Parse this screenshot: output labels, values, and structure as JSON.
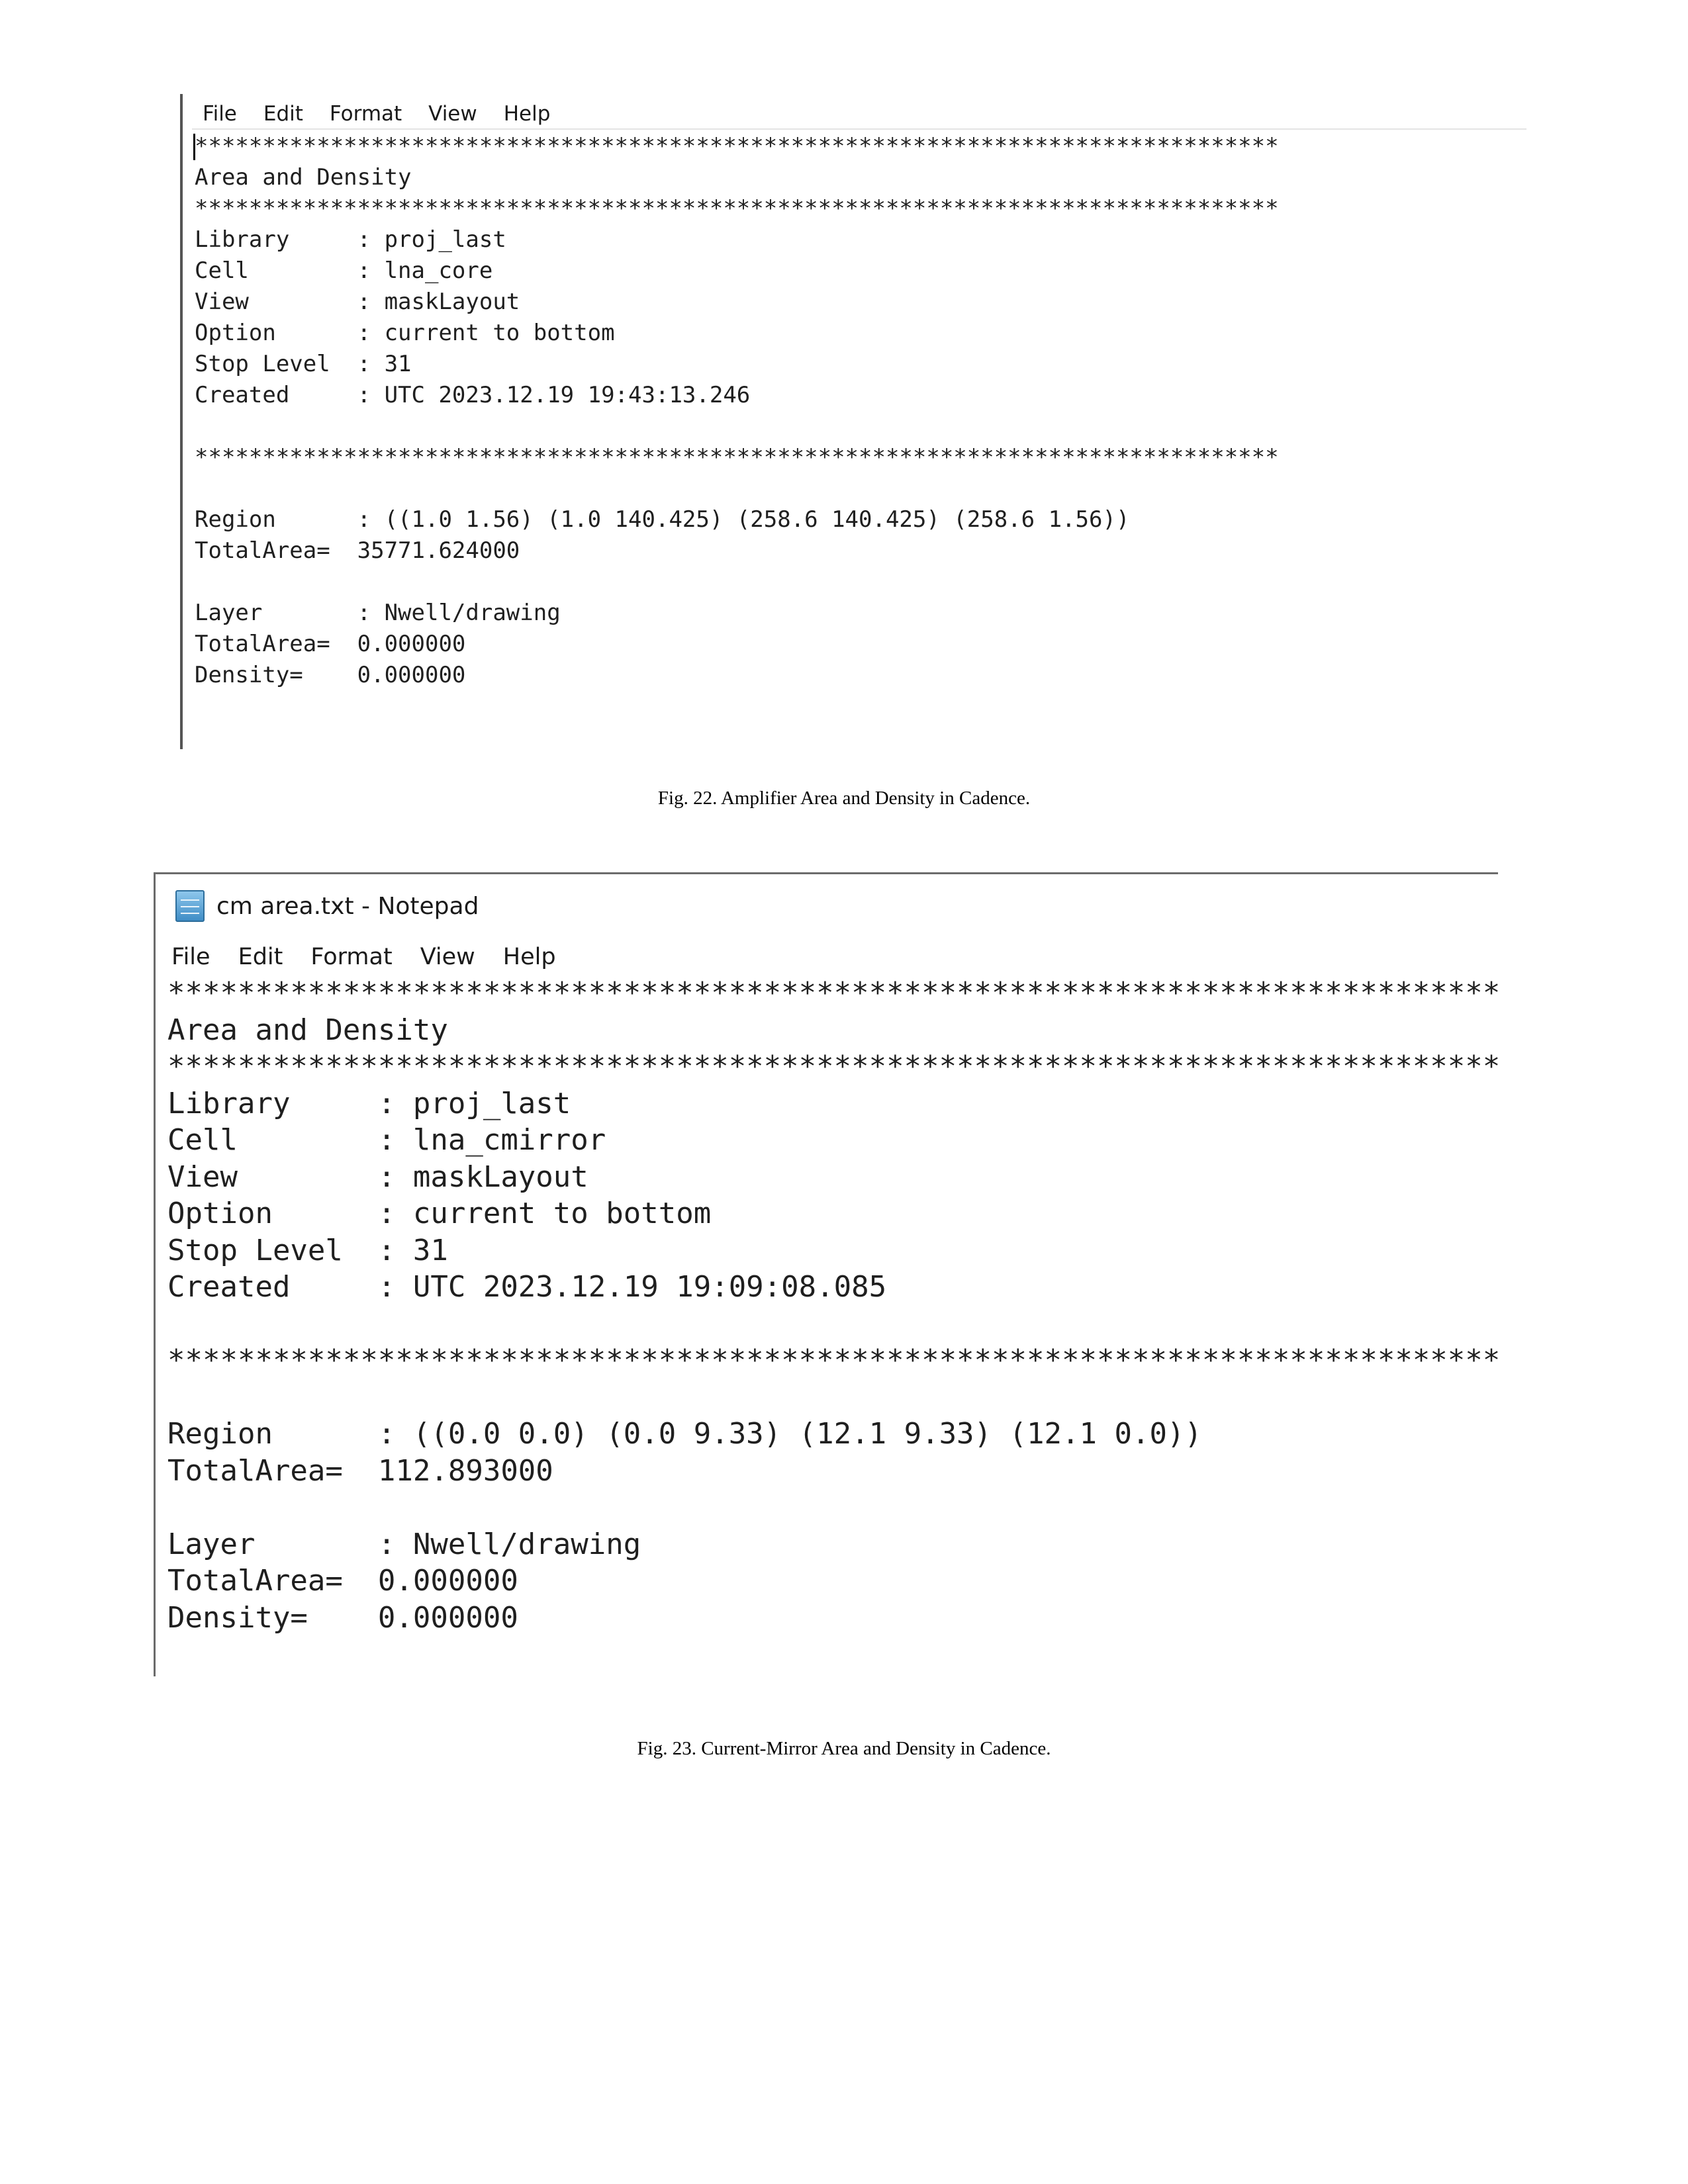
{
  "screenshot1": {
    "menu": [
      "File",
      "Edit",
      "Format",
      "View",
      "Help"
    ],
    "content": "********************************************************************************\nArea and Density\n********************************************************************************\nLibrary     : proj_last\nCell        : lna_core\nView        : maskLayout\nOption      : current to bottom\nStop Level  : 31\nCreated     : UTC 2023.12.19 19:43:13.246\n\n********************************************************************************\n\nRegion      : ((1.0 1.56) (1.0 140.425) (258.6 140.425) (258.6 1.56))\nTotalArea=  35771.624000\n\nLayer       : Nwell/drawing\nTotalArea=  0.000000\nDensity=    0.000000"
  },
  "caption1": "Fig. 22. Amplifier Area and Density in Cadence.",
  "screenshot2": {
    "window_title": "cm area.txt - Notepad",
    "menu": [
      "File",
      "Edit",
      "Format",
      "View",
      "Help"
    ],
    "content": "********************************************************************************:\nArea and Density\n********************************************************************************:\nLibrary     : proj_last\nCell        : lna_cmirror\nView        : maskLayout\nOption      : current to bottom\nStop Level  : 31\nCreated     : UTC 2023.12.19 19:09:08.085\n\n********************************************************************************:\n\nRegion      : ((0.0 0.0) (0.0 9.33) (12.1 9.33) (12.1 0.0))\nTotalArea=  112.893000\n\nLayer       : Nwell/drawing\nTotalArea=  0.000000\nDensity=    0.000000"
  },
  "caption2": "Fig. 23. Current-Mirror Area and Density in Cadence."
}
